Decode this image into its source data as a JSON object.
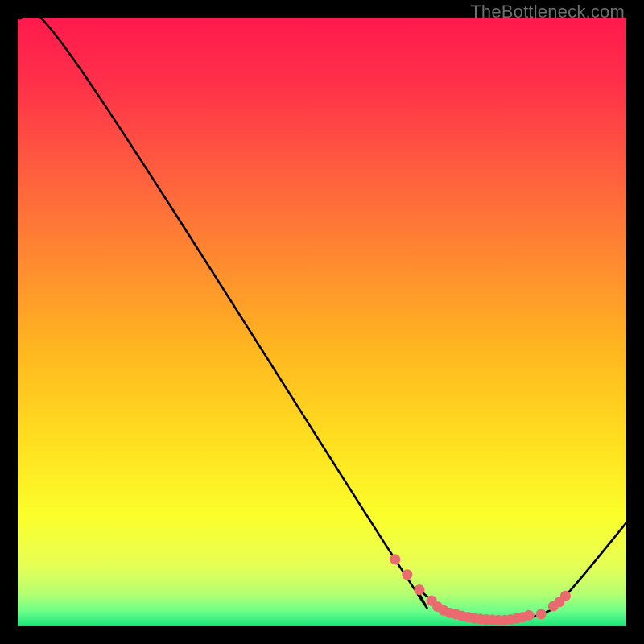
{
  "watermark": "TheBottleneck.com",
  "chart_data": {
    "type": "line",
    "title": "",
    "xlabel": "",
    "ylabel": "",
    "xlim": [
      0,
      100
    ],
    "ylim": [
      0,
      100
    ],
    "curve": [
      {
        "x": 0,
        "y": 100
      },
      {
        "x": 10,
        "y": 92
      },
      {
        "x": 62,
        "y": 11
      },
      {
        "x": 66,
        "y": 6
      },
      {
        "x": 72,
        "y": 2
      },
      {
        "x": 80,
        "y": 1
      },
      {
        "x": 86,
        "y": 2
      },
      {
        "x": 90,
        "y": 5
      },
      {
        "x": 100,
        "y": 17
      }
    ],
    "markers": [
      {
        "x": 62,
        "y": 11
      },
      {
        "x": 64,
        "y": 8.5
      },
      {
        "x": 66,
        "y": 6
      },
      {
        "x": 68,
        "y": 4.2
      },
      {
        "x": 69,
        "y": 3.2
      },
      {
        "x": 70,
        "y": 2.6
      },
      {
        "x": 71,
        "y": 2.2
      },
      {
        "x": 72,
        "y": 2.0
      },
      {
        "x": 73,
        "y": 1.7
      },
      {
        "x": 74,
        "y": 1.5
      },
      {
        "x": 75,
        "y": 1.3
      },
      {
        "x": 76,
        "y": 1.2
      },
      {
        "x": 77,
        "y": 1.1
      },
      {
        "x": 78,
        "y": 1.05
      },
      {
        "x": 79,
        "y": 1.0
      },
      {
        "x": 80,
        "y": 1.0
      },
      {
        "x": 81,
        "y": 1.1
      },
      {
        "x": 82,
        "y": 1.3
      },
      {
        "x": 83,
        "y": 1.5
      },
      {
        "x": 84,
        "y": 1.8
      },
      {
        "x": 86,
        "y": 2.0
      },
      {
        "x": 88,
        "y": 3.3
      },
      {
        "x": 89,
        "y": 4.0
      },
      {
        "x": 90,
        "y": 5.0
      }
    ],
    "gradient_stops": [
      {
        "offset": 0.0,
        "color": "#ff1a4d"
      },
      {
        "offset": 0.1,
        "color": "#ff2e4a"
      },
      {
        "offset": 0.24,
        "color": "#ff5a40"
      },
      {
        "offset": 0.4,
        "color": "#ff8a30"
      },
      {
        "offset": 0.55,
        "color": "#ffb820"
      },
      {
        "offset": 0.7,
        "color": "#ffe020"
      },
      {
        "offset": 0.82,
        "color": "#fbff2b"
      },
      {
        "offset": 0.9,
        "color": "#e6ff55"
      },
      {
        "offset": 0.945,
        "color": "#b8ff70"
      },
      {
        "offset": 0.975,
        "color": "#6dff8a"
      },
      {
        "offset": 1.0,
        "color": "#17e67a"
      }
    ],
    "marker_color": "#e96a6f",
    "line_color": "#000000"
  }
}
